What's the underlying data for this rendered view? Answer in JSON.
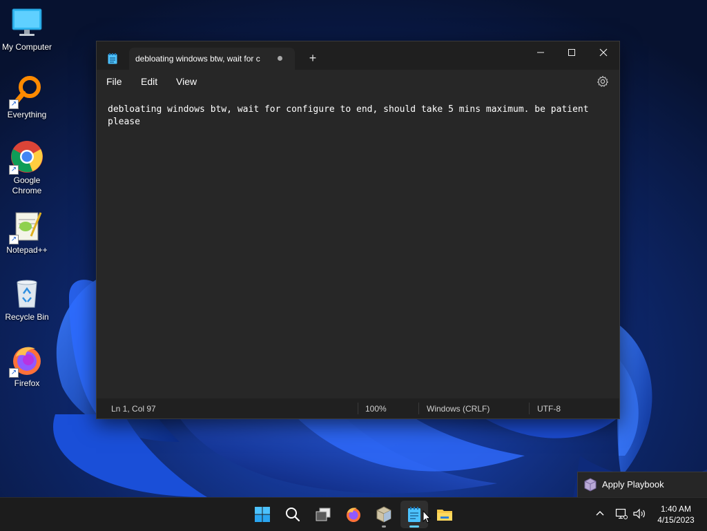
{
  "desktop": {
    "icons": [
      {
        "label": "My Computer"
      },
      {
        "label": "Everything"
      },
      {
        "label": "Google Chrome"
      },
      {
        "label": "Notepad++"
      },
      {
        "label": "Recycle Bin"
      },
      {
        "label": "Firefox"
      }
    ]
  },
  "notepad": {
    "tab_title": "debloating windows btw, wait for c",
    "new_tab_symbol": "+",
    "menu": {
      "file": "File",
      "edit": "Edit",
      "view": "View"
    },
    "content": "debloating windows btw, wait for configure to end, should take 5 mins maximum. be patient please",
    "status": {
      "position": "Ln 1, Col 97",
      "zoom": "100%",
      "line_ending": "Windows (CRLF)",
      "encoding": "UTF-8"
    }
  },
  "toast": {
    "label": "Apply Playbook"
  },
  "taskbar": {
    "apps": [
      {
        "name": "start-icon"
      },
      {
        "name": "search-icon"
      },
      {
        "name": "task-view-icon"
      },
      {
        "name": "firefox-icon"
      },
      {
        "name": "playbook-app-icon"
      },
      {
        "name": "notepad-icon"
      },
      {
        "name": "file-explorer-icon"
      }
    ],
    "clock": {
      "time": "1:40 AM",
      "date": "4/15/2023"
    }
  },
  "colors": {
    "accent": "#60cdff",
    "window_bg": "#272727",
    "taskbar_bg": "#1c1c1c"
  }
}
